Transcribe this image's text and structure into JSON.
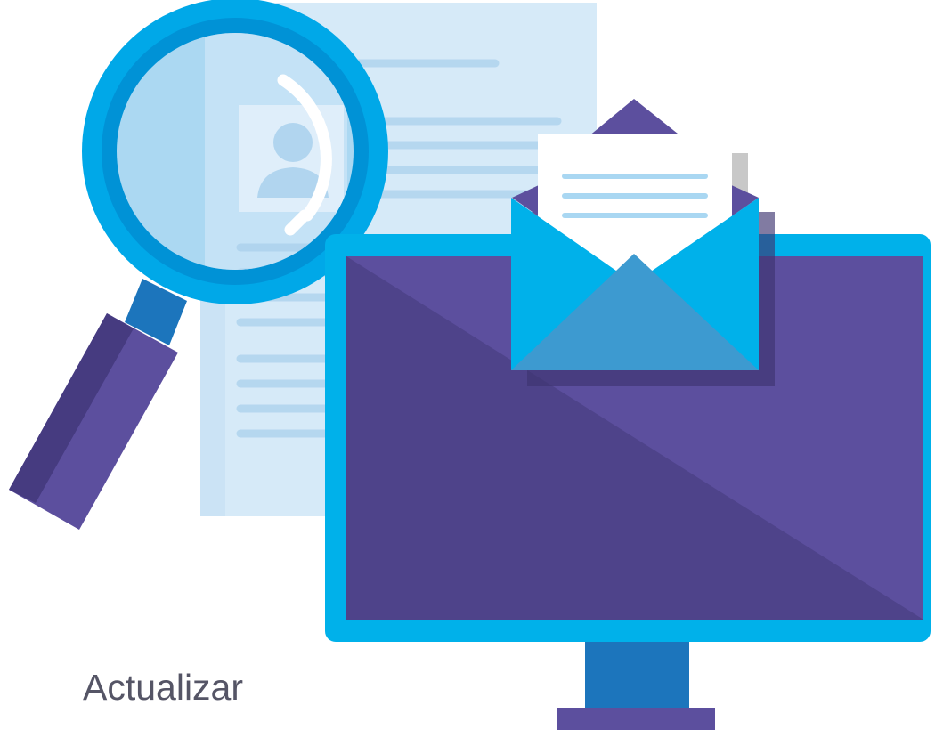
{
  "caption": {
    "text": "Actualizar"
  },
  "colors": {
    "document": "#d6eaf8",
    "document_lines": "#b5d7ef",
    "lens_ring": "#00a8e8",
    "lens_ring_dark": "#0077b6",
    "lens_glass": "#c9e4f7",
    "handle": "#5c4f9e",
    "handle_dark": "#463b80",
    "monitor_frame": "#00b1ea",
    "monitor_screen": "#5c4f9e",
    "monitor_screen_dark": "#4e438a",
    "monitor_stand": "#1c75bc",
    "monitor_base": "#5c4f9e",
    "envelope": "#00b1ea",
    "envelope_flap": "#5c4f9e",
    "letter": "#ffffff",
    "letter_lines": "#a9d7f2",
    "caption_text": "#555566"
  },
  "icons": [
    "document-icon",
    "magnifying-glass-icon",
    "monitor-icon",
    "envelope-icon"
  ]
}
